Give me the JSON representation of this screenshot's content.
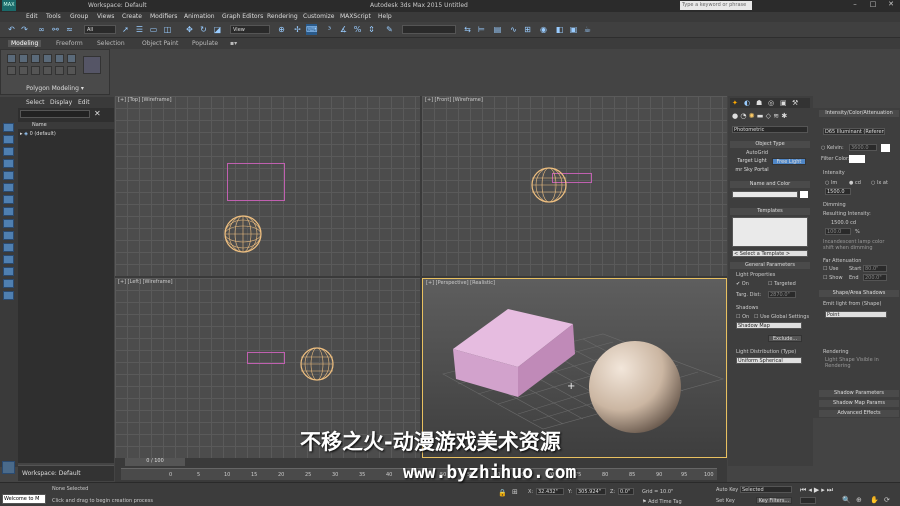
{
  "titlebar": {
    "title": "Autodesk 3ds Max 2015     Untitled",
    "workspace": "Workspace: Default",
    "search_placeholder": "Type a keyword or phrase"
  },
  "menu": [
    "Edit",
    "Tools",
    "Group",
    "Views",
    "Create",
    "Modifiers",
    "Animation",
    "Graph Editors",
    "Rendering",
    "Customize",
    "MAXScript",
    "Help"
  ],
  "toolbar": {
    "selection_filter": "All",
    "ref_coord": "View"
  },
  "ribbon": {
    "tabs": [
      "Modeling",
      "Freeform",
      "Selection",
      "Object Paint",
      "Populate"
    ],
    "panel_label": "Polygon Modeling"
  },
  "scene_explorer": {
    "tabs": [
      "Select",
      "Display",
      "Edit"
    ],
    "col_name": "Name",
    "root_item": "0 (default)",
    "workspace": "Workspace: Default"
  },
  "viewports": {
    "top": "[+] [Top] [Wireframe]",
    "front": "[+] [Front] [Wireframe]",
    "left": "[+] [Left] [Wireframe]",
    "persp": "[+] [Perspective] [Realistic]"
  },
  "command_panel": {
    "dropdown": "Photometric",
    "object_type": {
      "title": "Object Type",
      "autogrid": "AutoGrid",
      "target_light": "Target Light",
      "free_light": "Free Light",
      "sky_portal": "mr Sky Portal"
    },
    "name_color": "Name and Color",
    "templates": {
      "title": "Templates",
      "select": "< Select a Template >"
    },
    "general": {
      "title": "General Parameters",
      "light_props": "Light Properties",
      "on": "On",
      "targeted": "Targeted",
      "targ_dist_label": "Targ. Dist:",
      "targ_dist_value": "2870.0\"",
      "shadows": "Shadows",
      "shadows_on": "On",
      "use_global": "Use Global Settings",
      "shadow_type": "Shadow Map",
      "exclude": "Exclude...",
      "light_dist": "Light Distribution (Type)",
      "dist_value": "Uniform Spherical"
    }
  },
  "right_panel": {
    "intensity_title": "Intensity/Color/Attenuation",
    "illuminant": "D65 Illuminant (Reference)",
    "kelvin_label": "Kelvin:",
    "kelvin_value": "3600.0",
    "filter_color": "Filter Color:",
    "intensity": "Intensity",
    "units": [
      "lm",
      "cd",
      "lx at"
    ],
    "intensity_value": "1500.0",
    "dimming": "Dimming",
    "resulting": "Resulting Intensity:",
    "resulting_value": "1500.0 cd",
    "percent": "100.0",
    "incandescent": "Incandescent lamp color shift when dimming",
    "far_atten": "Far Attenuation",
    "use": "Use",
    "start_label": "Start",
    "start_value": "80.0\"",
    "show": "Show",
    "end_label": "End",
    "end_value": "200.0\"",
    "shape_title": "Shape/Area Shadows",
    "emit_from": "Emit light from (Shape)",
    "shape": "Point",
    "rendering": "Rendering",
    "light_shape_visible": "Light Shape Visible in Rendering",
    "rollups": [
      "Shadow Parameters",
      "Shadow Map Params",
      "Advanced Effects"
    ]
  },
  "timeline": {
    "frame": "0 / 100",
    "ticks": [
      "0",
      "5",
      "10",
      "15",
      "20",
      "25",
      "30",
      "35",
      "40",
      "45",
      "50",
      "55",
      "60",
      "65",
      "70",
      "75",
      "80",
      "85",
      "90",
      "95",
      "100"
    ]
  },
  "status": {
    "maxscript": "Welcome to M",
    "none_selected": "None Selected",
    "prompt": "Click and drag to begin creation process",
    "x_label": "X:",
    "x": "32.432\"",
    "y_label": "Y:",
    "y": "305.924\"",
    "z_label": "Z:",
    "z": "0.0\"",
    "grid": "Grid = 10.0\"",
    "add_time_tag": "Add Time Tag",
    "autokey": "Auto Key",
    "autokey_val": "Selected",
    "setkey": "Set Key",
    "key_filters": "Key Filters..."
  },
  "watermark": {
    "line1": "不移之火-动漫游戏美术资源",
    "line2": "www.byzhihuo.com"
  },
  "colors": {
    "selection": "#f0c080",
    "box_wire": "#c060b0",
    "box_fill": "#e0b0d8",
    "sphere": "#d8c4b0"
  }
}
